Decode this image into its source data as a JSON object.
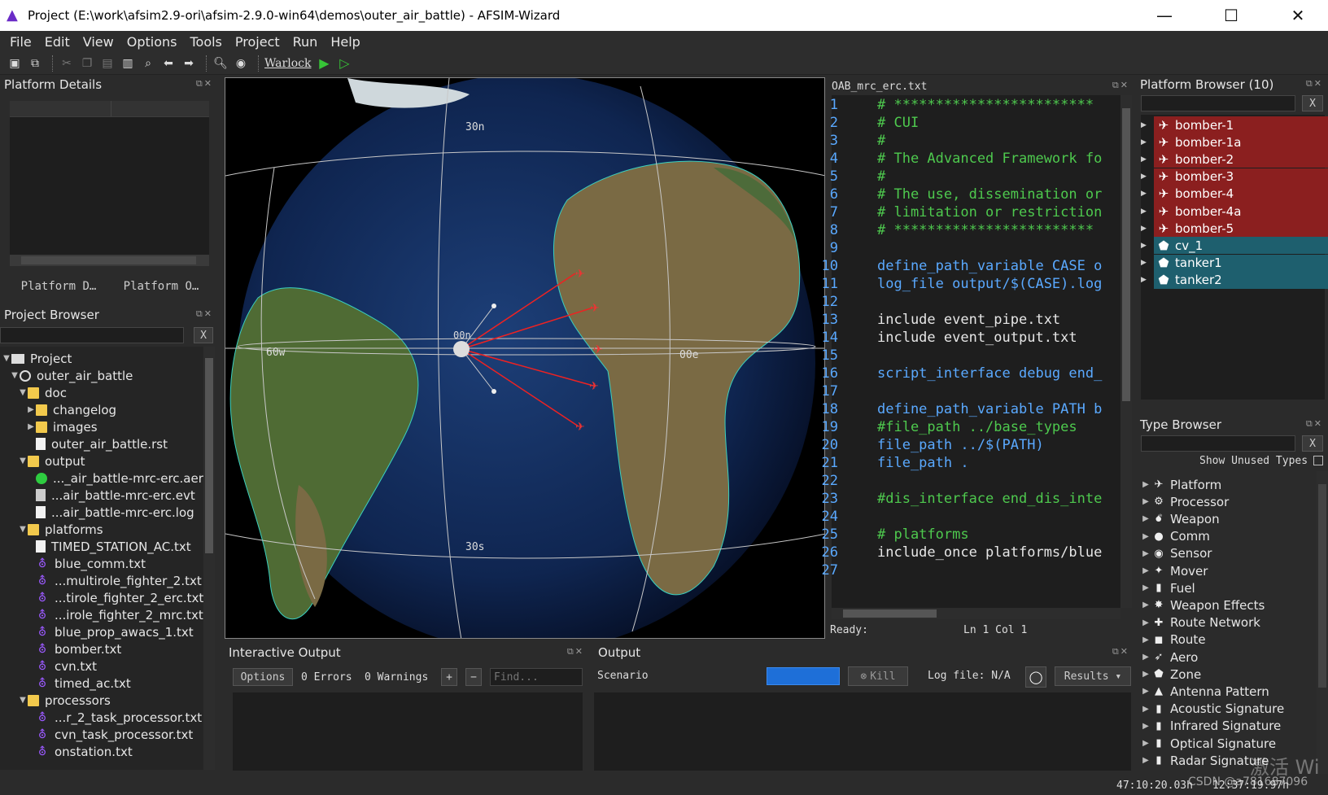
{
  "window": {
    "title": "Project (E:\\work\\afsim2.9-ori\\afsim-2.9.0-win64\\demos\\outer_air_battle) - AFSIM-Wizard",
    "minimize": "—",
    "maximize": "☐",
    "close": "✕"
  },
  "menu": [
    "File",
    "Edit",
    "View",
    "Options",
    "Tools",
    "Project",
    "Run",
    "Help"
  ],
  "toolbar": {
    "warlock": "Warlock"
  },
  "platform_details": {
    "title": "Platform Details",
    "tab1": "Platform D…",
    "tab2": "Platform O…"
  },
  "project_browser": {
    "title": "Project Browser",
    "filter_clear": "X",
    "items": [
      {
        "label": "Project"
      },
      {
        "label": "outer_air_battle"
      },
      {
        "label": "doc"
      },
      {
        "label": "changelog"
      },
      {
        "label": "images"
      },
      {
        "label": "outer_air_battle.rst"
      },
      {
        "label": "output"
      },
      {
        "label": "..._air_battle-mrc-erc.aer"
      },
      {
        "label": "...air_battle-mrc-erc.evt"
      },
      {
        "label": "...air_battle-mrc-erc.log"
      },
      {
        "label": "platforms"
      },
      {
        "label": "TIMED_STATION_AC.txt"
      },
      {
        "label": "blue_comm.txt"
      },
      {
        "label": "...multirole_fighter_2.txt"
      },
      {
        "label": "...tirole_fighter_2_erc.txt"
      },
      {
        "label": "...irole_fighter_2_mrc.txt"
      },
      {
        "label": "blue_prop_awacs_1.txt"
      },
      {
        "label": "bomber.txt"
      },
      {
        "label": "cvn.txt"
      },
      {
        "label": "timed_ac.txt"
      },
      {
        "label": "processors"
      },
      {
        "label": "...r_2_task_processor.txt"
      },
      {
        "label": "cvn_task_processor.txt"
      },
      {
        "label": "onstation.txt"
      }
    ]
  },
  "map": {
    "lat_n": "30n",
    "lat_s": "30s",
    "lon_w": "60w",
    "lon_e": "00e",
    "origin": "00n"
  },
  "editor": {
    "filename": "OAB_mrc_erc.txt",
    "lines": [
      {
        "n": "1",
        "t": "# ************************",
        "c": "comment"
      },
      {
        "n": "2",
        "t": "# CUI",
        "c": "comment"
      },
      {
        "n": "3",
        "t": "#",
        "c": "comment"
      },
      {
        "n": "4",
        "t": "# The Advanced Framework fo",
        "c": "comment"
      },
      {
        "n": "5",
        "t": "#",
        "c": "comment"
      },
      {
        "n": "6",
        "t": "# The use, dissemination or",
        "c": "comment"
      },
      {
        "n": "7",
        "t": "# limitation or restriction",
        "c": "comment"
      },
      {
        "n": "8",
        "t": "# ************************",
        "c": "comment"
      },
      {
        "n": "9",
        "t": "",
        "c": "plain"
      },
      {
        "n": "10",
        "t": "define_path_variable CASE o",
        "c": "kw"
      },
      {
        "n": "11",
        "t": "log_file output/$(CASE).log",
        "c": "kw"
      },
      {
        "n": "12",
        "t": "",
        "c": "plain"
      },
      {
        "n": "13",
        "t": "include event_pipe.txt",
        "c": "plain"
      },
      {
        "n": "14",
        "t": "include event_output.txt",
        "c": "plain"
      },
      {
        "n": "15",
        "t": "",
        "c": "plain"
      },
      {
        "n": "16",
        "t": "script_interface debug end_",
        "c": "kw"
      },
      {
        "n": "17",
        "t": "",
        "c": "plain"
      },
      {
        "n": "18",
        "t": "define_path_variable PATH b",
        "c": "kw"
      },
      {
        "n": "19",
        "t": "#file_path ../base_types",
        "c": "comment"
      },
      {
        "n": "20",
        "t": "file_path ../$(PATH)",
        "c": "kw"
      },
      {
        "n": "21",
        "t": "file_path .",
        "c": "kw"
      },
      {
        "n": "22",
        "t": "",
        "c": "plain"
      },
      {
        "n": "23",
        "t": "#dis_interface end_dis_inte",
        "c": "comment"
      },
      {
        "n": "24",
        "t": "",
        "c": "plain"
      },
      {
        "n": "25",
        "t": "# platforms",
        "c": "comment"
      },
      {
        "n": "26",
        "t": "include_once platforms/blue",
        "c": "plain"
      },
      {
        "n": "27",
        "t": "",
        "c": "plain"
      }
    ],
    "status_ready": "Ready:",
    "status_pos": "Ln 1 Col 1"
  },
  "platform_browser": {
    "title": "Platform Browser (10)",
    "filter_clear": "X",
    "items": [
      {
        "label": "bomber-1",
        "side": "red"
      },
      {
        "label": "bomber-1a",
        "side": "red"
      },
      {
        "label": "bomber-2",
        "side": "red"
      },
      {
        "label": "bomber-3",
        "side": "red"
      },
      {
        "label": "bomber-4",
        "side": "red"
      },
      {
        "label": "bomber-4a",
        "side": "red"
      },
      {
        "label": "bomber-5",
        "side": "red"
      },
      {
        "label": "cv_1",
        "side": "blue"
      },
      {
        "label": "tanker1",
        "side": "blue"
      },
      {
        "label": "tanker2",
        "side": "blue"
      }
    ],
    "colors": {
      "red": "#8b1f1f",
      "blue": "#1e5f6e"
    }
  },
  "type_browser": {
    "title": "Type Browser",
    "filter_clear": "X",
    "show_unused": "Show Unused Types",
    "items": [
      {
        "label": "Platform"
      },
      {
        "label": "Processor"
      },
      {
        "label": "Weapon"
      },
      {
        "label": "Comm"
      },
      {
        "label": "Sensor"
      },
      {
        "label": "Mover"
      },
      {
        "label": "Fuel"
      },
      {
        "label": "Weapon Effects"
      },
      {
        "label": "Route Network"
      },
      {
        "label": "Route"
      },
      {
        "label": "Aero"
      },
      {
        "label": "Zone"
      },
      {
        "label": "Antenna Pattern"
      },
      {
        "label": "Acoustic Signature"
      },
      {
        "label": "Infrared Signature"
      },
      {
        "label": "Optical Signature"
      },
      {
        "label": "Radar Signature"
      }
    ]
  },
  "interactive_output": {
    "title": "Interactive Output",
    "options": "Options",
    "errors": "0 Errors",
    "warnings": "0 Warnings",
    "plus": "+",
    "minus": "−",
    "find_placeholder": "Find..."
  },
  "output": {
    "title": "Output",
    "scenario": "Scenario",
    "kill": "Kill",
    "log_file": "Log file: N/A",
    "results": "Results"
  },
  "statusbar": {
    "time1": "47:10:20.03h",
    "time2": "12:37:19.97h",
    "watermark1": "激活 Wi",
    "watermark2": "CSDN @a781687096"
  }
}
